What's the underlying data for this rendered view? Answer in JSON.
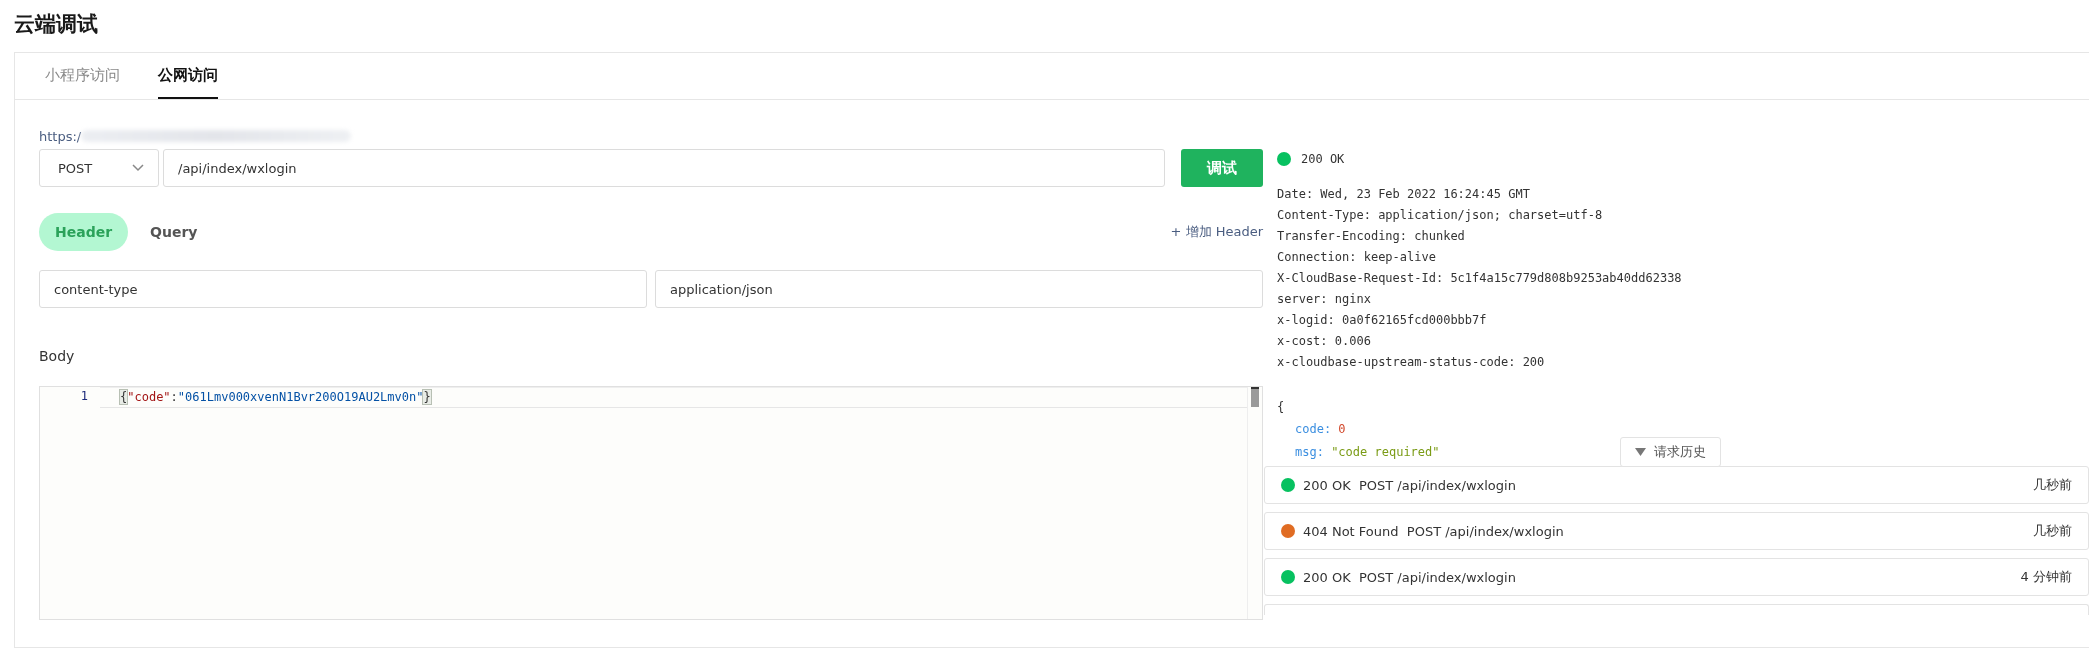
{
  "page_title": "云端调试",
  "tabs": [
    {
      "label": "小程序访问",
      "selected": false
    },
    {
      "label": "公网访问",
      "selected": true
    }
  ],
  "url_prefix": "https:/",
  "request": {
    "method": "POST",
    "path": "/api/index/wxlogin",
    "send_button": "调试"
  },
  "param_tabs": [
    {
      "label": "Header",
      "selected": true
    },
    {
      "label": "Query",
      "selected": false
    }
  ],
  "add_header": "+ 增加 Header",
  "headers": [
    {
      "key": "content-type",
      "value": "application/json"
    }
  ],
  "body": {
    "label": "Body",
    "lines": [
      {
        "number": "1",
        "tokens": [
          {
            "kind": "punct",
            "text": "{"
          },
          {
            "kind": "key",
            "text": "\"code\""
          },
          {
            "kind": "plain",
            "text": ":"
          },
          {
            "kind": "string",
            "text": "\"061Lmv000xvenN1Bvr200O19AU2Lmv0n\""
          },
          {
            "kind": "punct",
            "text": "}"
          }
        ]
      }
    ]
  },
  "response": {
    "status": "200 OK",
    "color": "#07c160",
    "headers": [
      "Date: Wed, 23 Feb 2022 16:24:45 GMT",
      "Content-Type: application/json; charset=utf-8",
      "Transfer-Encoding: chunked",
      "Connection: keep-alive",
      "X-CloudBase-Request-Id: 5c1f4a15c779d808b9253ab40dd62338",
      "server: nginx",
      "x-logid: 0a0f62165fcd000bbb7f",
      "x-cost: 0.006",
      "x-cloudbase-upstream-status-code: 200"
    ],
    "json_open": "{",
    "fields": [
      {
        "key": "code:",
        "value": "0",
        "kind": "number"
      },
      {
        "key": "msg:",
        "value": "\"code required\"",
        "kind": "string"
      }
    ]
  },
  "history": {
    "button": "请求历史",
    "expanded": true,
    "items": [
      {
        "status": "200 OK",
        "request": "POST /api/index/wxlogin",
        "time": "几秒前",
        "color": "#07c160"
      },
      {
        "status": "404 Not Found",
        "request": "POST /api/index/wxlogin",
        "time": "几秒前",
        "color": "#e06c23"
      },
      {
        "status": "200 OK",
        "request": "POST /api/index/wxlogin",
        "time": "4 分钟前",
        "color": "#07c160"
      }
    ]
  }
}
